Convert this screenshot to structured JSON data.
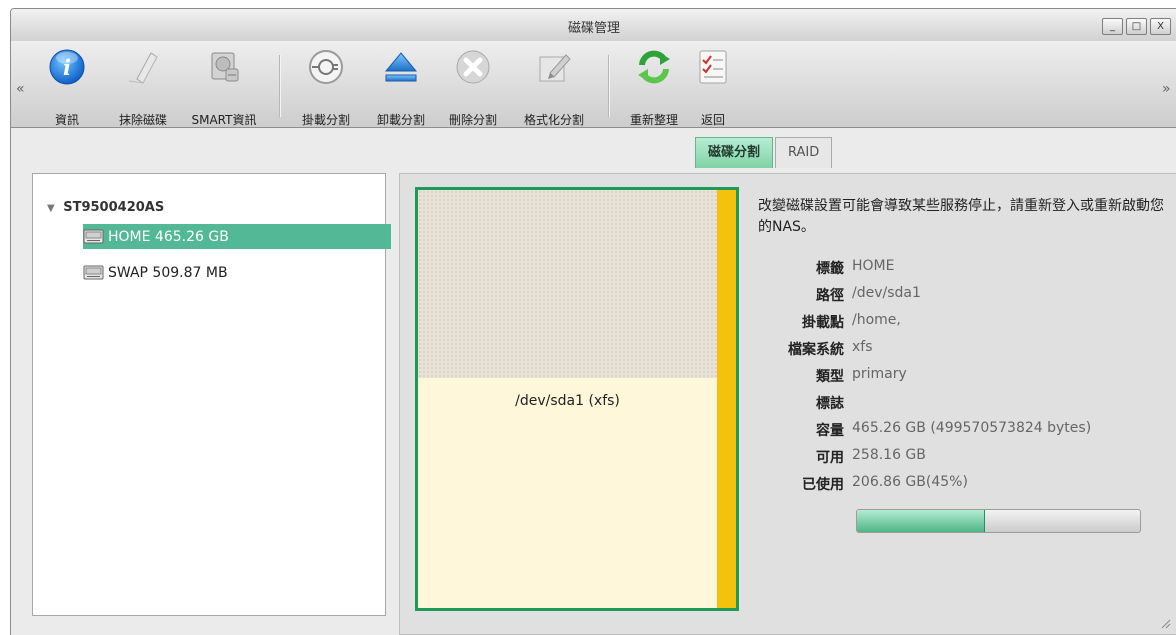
{
  "window": {
    "title": "磁碟管理",
    "controls": {
      "minimize": "_",
      "maximize": "□",
      "close": "X"
    }
  },
  "toolbar": {
    "scroll_left": "«",
    "scroll_right": "»",
    "buttons": [
      {
        "label": "資訊",
        "icon": "info-icon"
      },
      {
        "label": "抹除磁碟",
        "icon": "eraser-icon"
      },
      {
        "label": "SMART資訊",
        "icon": "disk-health-icon"
      },
      {
        "label": "掛載分割",
        "icon": "mount-icon"
      },
      {
        "label": "卸載分割",
        "icon": "eject-icon"
      },
      {
        "label": "刪除分割",
        "icon": "delete-icon"
      },
      {
        "label": "格式化分割",
        "icon": "format-icon"
      },
      {
        "label": "重新整理",
        "icon": "refresh-icon"
      },
      {
        "label": "返回",
        "icon": "checklist-icon"
      }
    ]
  },
  "tabs": [
    {
      "label": "磁碟分割",
      "active": true
    },
    {
      "label": "RAID",
      "active": false
    }
  ],
  "tree": {
    "disk": "ST9500420AS",
    "items": [
      {
        "label": "HOME 465.26 GB",
        "selected": true
      },
      {
        "label": "SWAP 509.87 MB",
        "selected": false
      }
    ]
  },
  "partition": {
    "name": "/dev/sda1 (xfs)",
    "used_fraction": 0.45,
    "colors": {
      "border": "#1b9a58",
      "bar": "#f4c20d",
      "free": "#fff7da"
    }
  },
  "details": {
    "warning": "改變磁碟設置可能會導致某些服務停止，請重新登入或重新啟動您的NAS。",
    "properties": [
      {
        "key": "標籤",
        "value": "HOME"
      },
      {
        "key": "路徑",
        "value": "/dev/sda1"
      },
      {
        "key": "掛載點",
        "value": "/home,"
      },
      {
        "key": "檔案系統",
        "value": "xfs"
      },
      {
        "key": "類型",
        "value": "primary"
      },
      {
        "key": "標誌",
        "value": ""
      },
      {
        "key": "容量",
        "value": "465.26 GB (499570573824 bytes)"
      },
      {
        "key": "可用",
        "value": "258.16 GB"
      },
      {
        "key": "已使用",
        "value": "206.86 GB(45%)"
      }
    ],
    "usage_percent": 45
  }
}
